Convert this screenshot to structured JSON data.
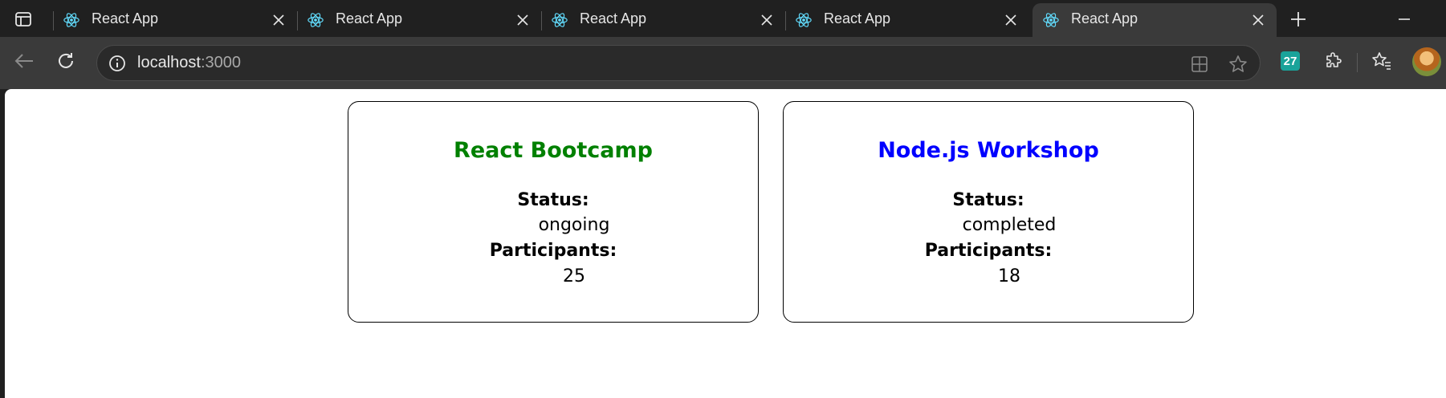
{
  "browser": {
    "tabs": [
      {
        "title": "React App",
        "active": false
      },
      {
        "title": "React App",
        "active": false
      },
      {
        "title": "React App",
        "active": false
      },
      {
        "title": "React App",
        "active": false
      },
      {
        "title": "React App",
        "active": true
      }
    ],
    "url": {
      "host": "localhost",
      "port": ":3000"
    },
    "extension_badge": "27"
  },
  "cards": [
    {
      "title": "React Bootcamp",
      "title_color": "#008000",
      "status_label": "Status:",
      "status": "ongoing",
      "participants_label": "Participants:",
      "participants": "25"
    },
    {
      "title": "Node.js Workshop",
      "title_color": "#0000ff",
      "status_label": "Status:",
      "status": "completed",
      "participants_label": "Participants:",
      "participants": "18"
    }
  ]
}
